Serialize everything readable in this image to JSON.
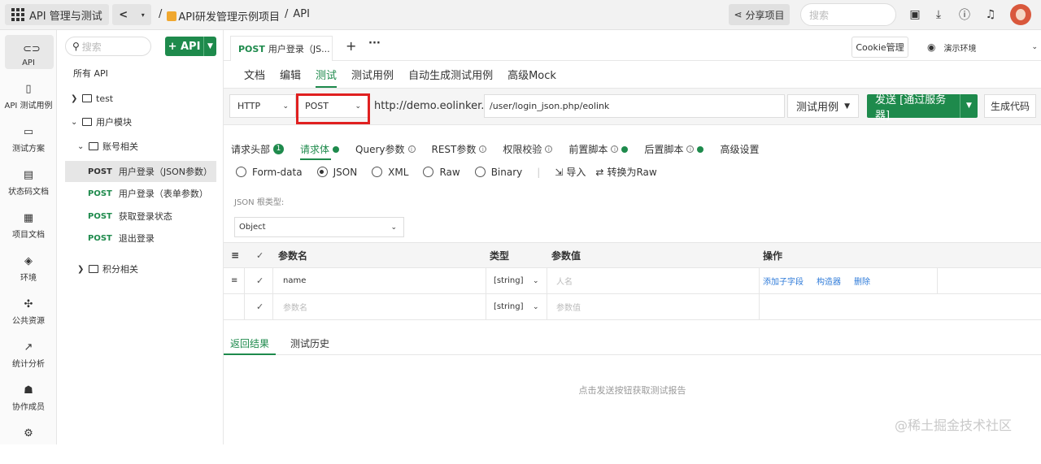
{
  "topbar": {
    "app_title": "API 管理与测试",
    "back_label": "<",
    "breadcrumb": [
      "/",
      "API研发管理示例项目",
      "/",
      "API"
    ],
    "share_label": "分享项目",
    "search_placeholder": "搜索"
  },
  "leftnav": [
    {
      "label": "API",
      "icon": "link-icon"
    },
    {
      "label": "API 测试用例",
      "icon": "clipboard-icon"
    },
    {
      "label": "测试方案",
      "icon": "calendar-icon"
    },
    {
      "label": "状态码文档",
      "icon": "doc-icon"
    },
    {
      "label": "项目文档",
      "icon": "list-doc-icon"
    },
    {
      "label": "环境",
      "icon": "cube-icon"
    },
    {
      "label": "公共资源",
      "icon": "puzzle-icon"
    },
    {
      "label": "统计分析",
      "icon": "chart-icon"
    },
    {
      "label": "协作成员",
      "icon": "users-icon"
    }
  ],
  "tree": {
    "search_placeholder": "搜索",
    "add_label": "+ API",
    "all_label": "所有 API",
    "folder_test": "test",
    "folder_user": "用户模块",
    "folder_account": "账号相关",
    "apis": [
      {
        "method": "POST",
        "name": "用户登录（JSON参数）"
      },
      {
        "method": "POST",
        "name": "用户登录（表单参数）"
      },
      {
        "method": "POST",
        "name": "获取登录状态"
      },
      {
        "method": "POST",
        "name": "退出登录"
      }
    ],
    "folder_points": "积分相关"
  },
  "tabs": {
    "doc_method": "POST",
    "doc_title": "用户登录（JS...",
    "plus": "+",
    "more": "···",
    "cookie_label": "Cookie管理",
    "env_label": "演示环境"
  },
  "subtabs": [
    "文档",
    "编辑",
    "测试",
    "测试用例",
    "自动生成测试用例",
    "高级Mock"
  ],
  "request": {
    "protocol": "HTTP",
    "method": "POST",
    "host": "http://demo.eolinker.com",
    "path": "/user/login_json.php/eolink",
    "case_label": "测试用例",
    "send_label": "发送 [通过服务器]",
    "gen_label": "生成代码"
  },
  "param_tabs": {
    "headers": "请求头部",
    "headers_count": "1",
    "body": "请求体",
    "query": "Query参数",
    "rest": "REST参数",
    "auth": "权限校验",
    "pre": "前置脚本",
    "post": "后置脚本",
    "advanced": "高级设置"
  },
  "body_types": {
    "options": [
      "Form-data",
      "JSON",
      "XML",
      "Raw",
      "Binary"
    ],
    "selected": "JSON",
    "import": "导入",
    "to_raw": "转换为Raw"
  },
  "json_root": {
    "label": "JSON 根类型:",
    "value": "Object"
  },
  "param_table": {
    "headers": {
      "name": "参数名",
      "type": "类型",
      "value": "参数值",
      "ops": "操作"
    },
    "rows": [
      {
        "name": "name",
        "type": "[string]",
        "value_placeholder": "人名",
        "ops": [
          "添加子字段",
          "构造器",
          "删除"
        ]
      },
      {
        "name_placeholder": "参数名",
        "type": "[string]",
        "value_placeholder": "参数值"
      }
    ]
  },
  "result": {
    "tabs": [
      "返回结果",
      "测试历史"
    ],
    "empty": "点击发送按钮获取测试报告"
  },
  "watermark": "@稀土掘金技术社区",
  "colors": {
    "accent": "#1e8a4c",
    "highlight": "#e02020",
    "link": "#2f7bd9"
  }
}
